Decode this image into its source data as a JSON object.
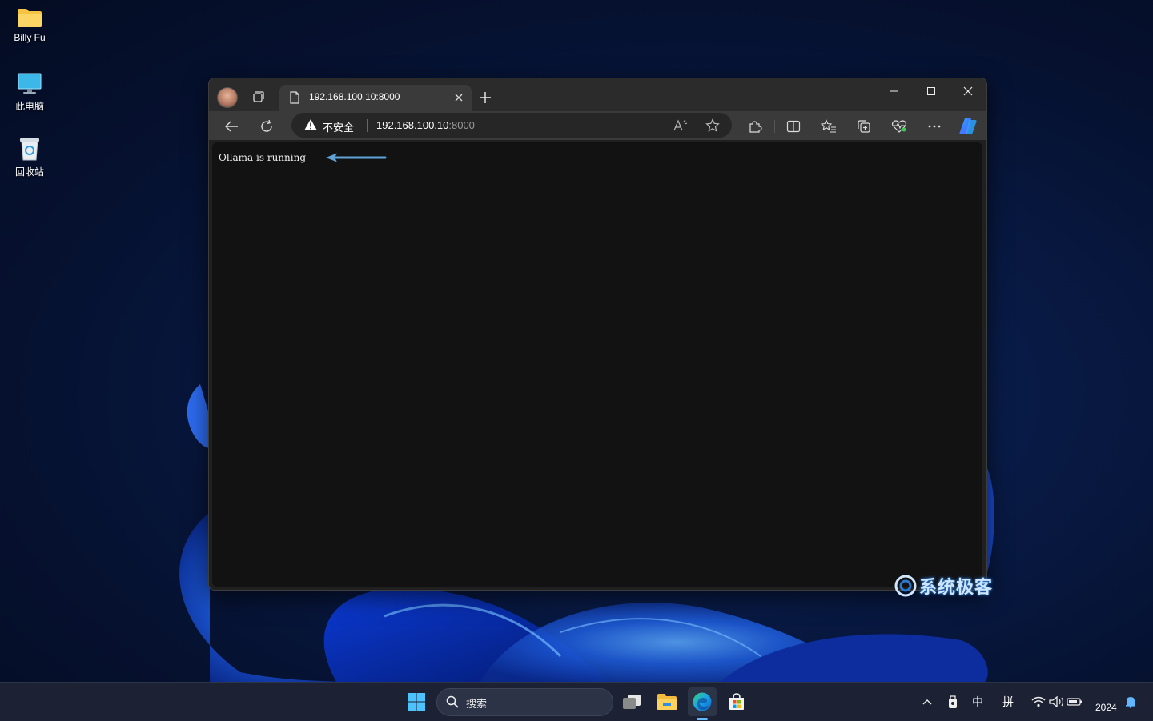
{
  "desktop": {
    "icons": [
      {
        "label": "Billy Fu",
        "icon": "folder-icon"
      },
      {
        "label": "此电脑",
        "icon": "computer-icon"
      },
      {
        "label": "回收站",
        "icon": "recycle-bin-icon"
      }
    ]
  },
  "browser": {
    "tab": {
      "title": "192.168.100.10:8000",
      "icon": "page-icon"
    },
    "address": {
      "security_label": "不安全",
      "url_host": "192.168.100.10",
      "url_port": ":8000"
    },
    "page": {
      "body_text": "Ollama is running"
    },
    "annotation_arrow_color": "#5fa3d6"
  },
  "watermark": {
    "text": "系统极客"
  },
  "taskbar": {
    "search_placeholder": "搜索",
    "tray": {
      "ime_mode": "中",
      "ime_input": "拼",
      "clock_year": "2024"
    }
  },
  "colors": {
    "taskbar_bg": "#1c2233",
    "content_bg": "#121212",
    "accent": "#62b7ff"
  }
}
